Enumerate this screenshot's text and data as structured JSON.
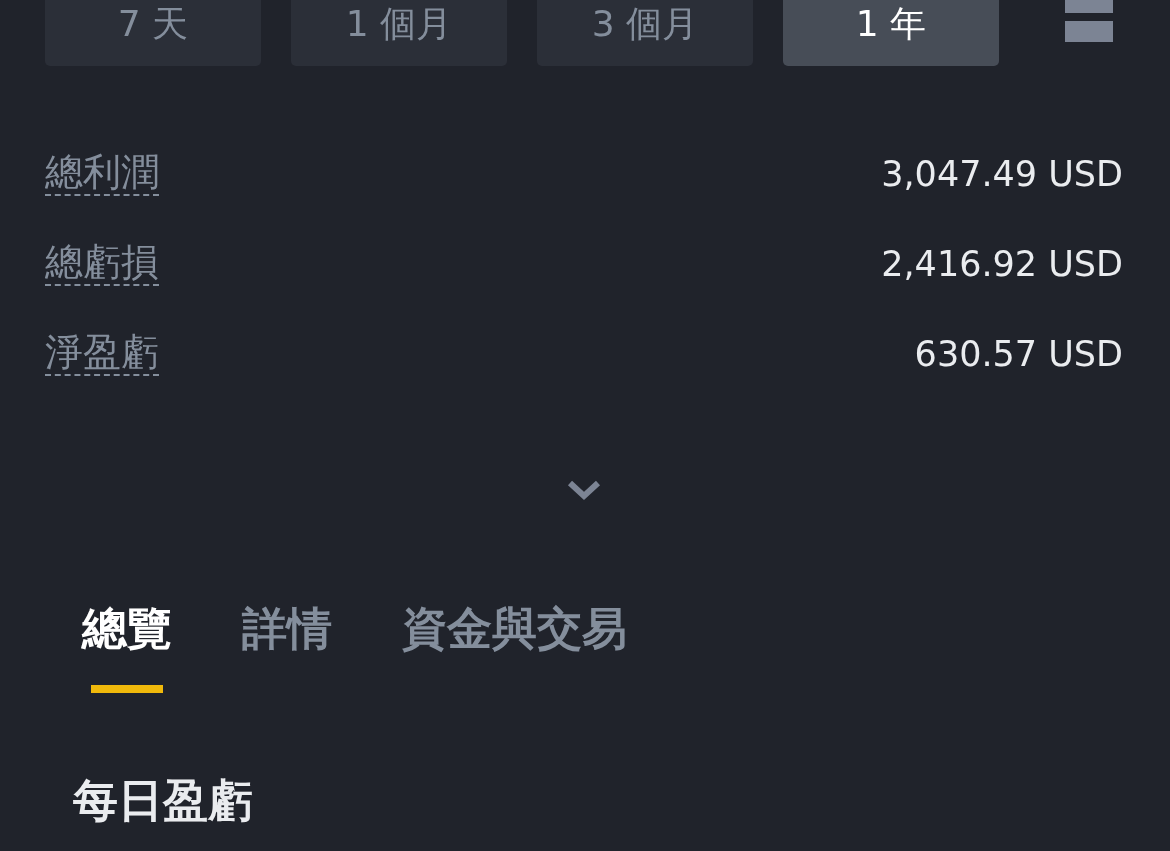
{
  "periods": [
    {
      "label": "7 天",
      "selected": false
    },
    {
      "label": "1 個月",
      "selected": false
    },
    {
      "label": "3 個月",
      "selected": false
    },
    {
      "label": "1 年",
      "selected": true
    }
  ],
  "stats": [
    {
      "label": "總利潤",
      "value": "3,047.49 USD"
    },
    {
      "label": "總虧損",
      "value": "2,416.92 USD"
    },
    {
      "label": "淨盈虧",
      "value": "630.57 USD"
    }
  ],
  "tabs": [
    {
      "label": "總覽",
      "selected": true
    },
    {
      "label": "詳情",
      "selected": false
    },
    {
      "label": "資金與交易",
      "selected": false
    }
  ],
  "section_title": "每日盈虧"
}
